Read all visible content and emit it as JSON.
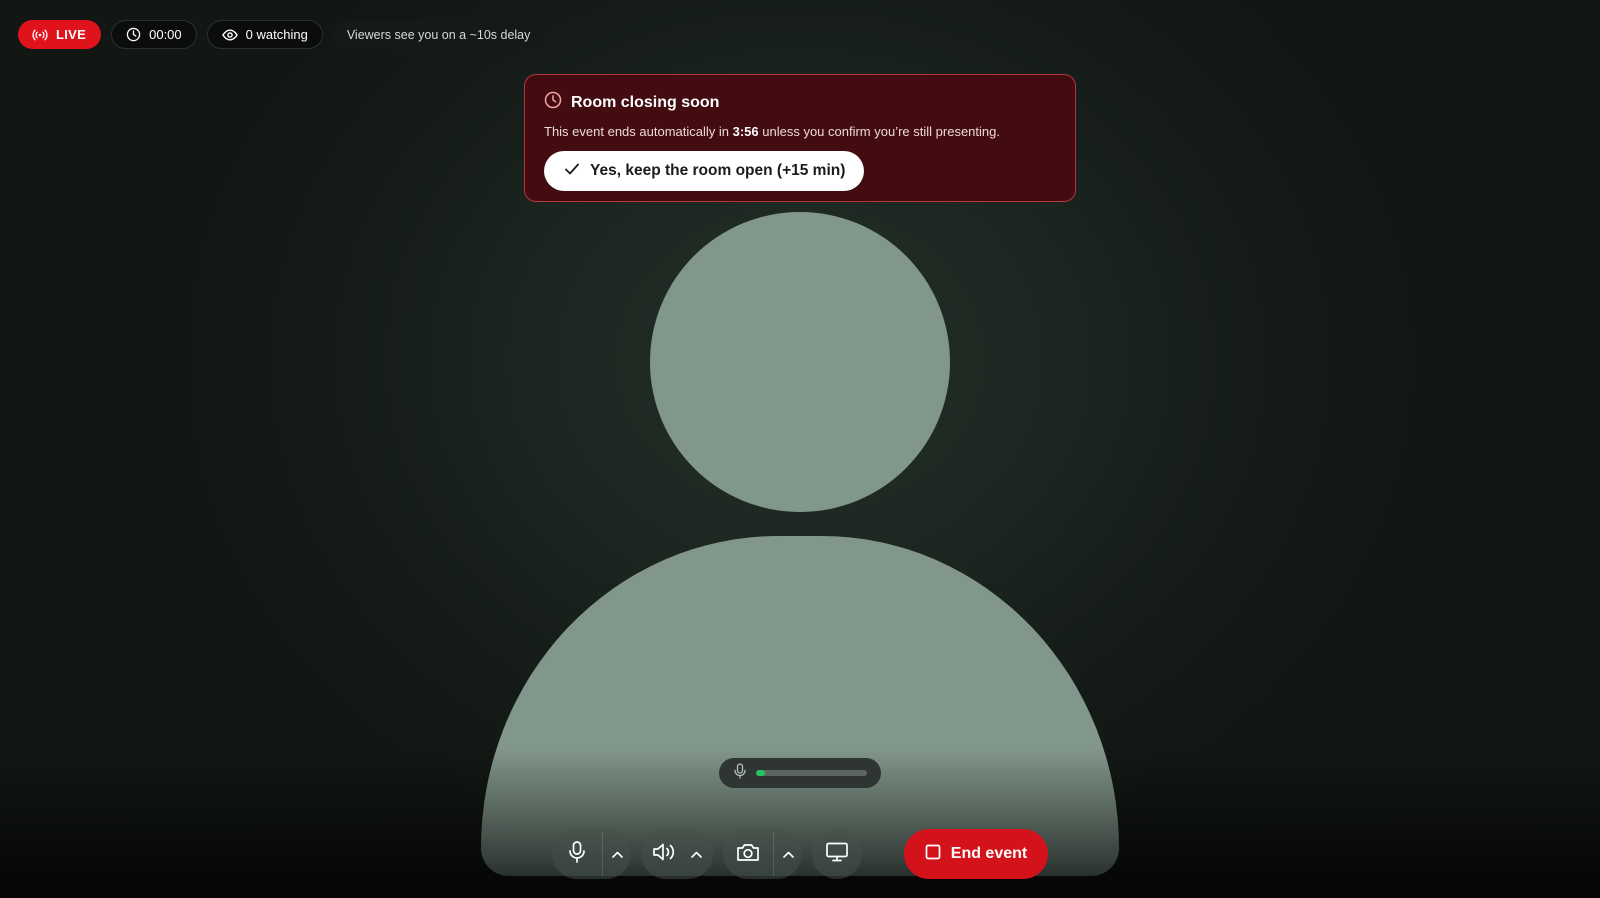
{
  "status": {
    "live_label": "LIVE",
    "timer": "00:00",
    "viewers": "0 watching",
    "delay_note": "Viewers see you on a ~10s delay"
  },
  "banner": {
    "title": "Room closing soon",
    "body_prefix": "This event ends automatically in ",
    "countdown": "3:56",
    "body_suffix": " unless you confirm you’re still presenting.",
    "keep_button": "Yes, keep the room open (+15 min)"
  },
  "mic_level": 0.08,
  "controls": {
    "end_label": "End event"
  },
  "colors": {
    "live": "#e0121c",
    "banner_bg": "#430c10",
    "banner_border": "#b3363d",
    "meter": "#22c55e",
    "end_button": "#d3121b",
    "avatar": "#82978b"
  },
  "icons": [
    "live-broadcast-icon",
    "clock-icon",
    "eye-icon",
    "check-icon",
    "mic-icon",
    "chevron-up-icon",
    "speaker-icon",
    "camera-icon",
    "monitor-icon",
    "stop-square-icon"
  ]
}
